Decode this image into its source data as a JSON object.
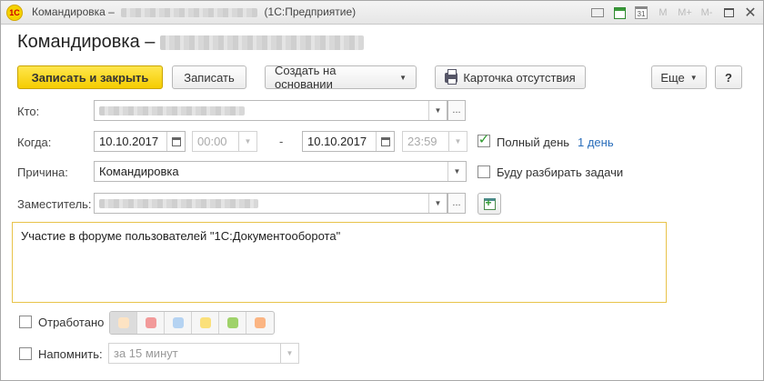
{
  "window": {
    "title": "Командировка –",
    "app_suffix": "(1С:Предприятие)",
    "logo_text": "1С"
  },
  "header": {
    "title": "Командировка –"
  },
  "toolbar": {
    "save_close": "Записать и закрыть",
    "save": "Записать",
    "create_based": "Создать на основании",
    "absence_card": "Карточка отсутствия",
    "more": "Еще",
    "help": "?"
  },
  "form": {
    "who_label": "Кто:",
    "when_label": "Когда:",
    "date_from": "10.10.2017",
    "time_from": "00:00",
    "dash": "-",
    "date_to": "10.10.2017",
    "time_to": "23:59",
    "full_day_label": "Полный день",
    "full_day_checked": true,
    "duration": "1 день",
    "reason_label": "Причина:",
    "reason_value": "Командировка",
    "handle_tasks_label": "Буду разбирать задачи",
    "handle_tasks_checked": false,
    "substitute_label": "Заместитель:",
    "description": "Участие в форуме пользователей \"1С:Документооборота\"",
    "worked_off_label": "Отработано",
    "worked_off_checked": false,
    "remind_label": "Напомнить:",
    "remind_checked": false,
    "remind_value": "за 15 минут"
  },
  "colors": {
    "accent_yellow": "#f5cc00",
    "textarea_border": "#e8c34a",
    "swatches": [
      "#fde3c3",
      "#f29a9a",
      "#b5d3f2",
      "#fbe07a",
      "#9fd26a",
      "#fbb583"
    ]
  }
}
